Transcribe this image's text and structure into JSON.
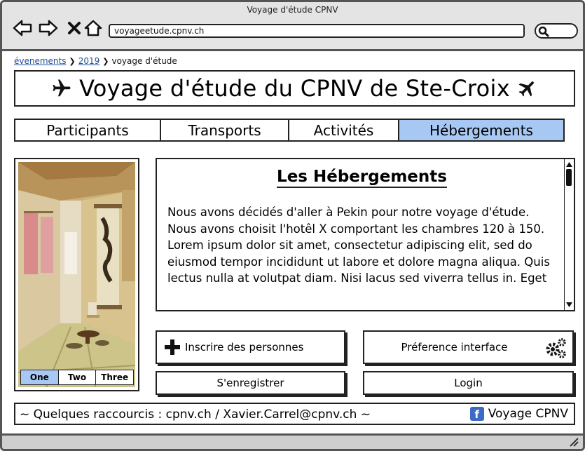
{
  "window": {
    "title": "Voyage d'étude CPNV",
    "url": "voyageetude.cpnv.ch"
  },
  "breadcrumb": {
    "items": [
      "évenements",
      "2019",
      "voyage d'étude"
    ]
  },
  "header": {
    "title": "Voyage d'étude du CPNV de Ste-Croix"
  },
  "tabs": [
    {
      "label": "Participants",
      "active": false
    },
    {
      "label": "Transports",
      "active": false
    },
    {
      "label": "Activités",
      "active": false
    },
    {
      "label": "Hébergements",
      "active": true
    }
  ],
  "carousel": {
    "buttons": [
      "One",
      "Two",
      "Three"
    ],
    "selected": "One"
  },
  "content": {
    "heading": "Les Hébergements",
    "body": "Nous avons décidés d'aller à Pekin pour notre voyage d'étude. Nous avons choisit l'hotêl X comportant les chambres 120 à 150. Lorem ipsum dolor sit amet, consectetur adipiscing elit, sed do eiusmod tempor incididunt ut labore et dolore magna aliqua. Quis lectus nulla at volutpat diam. Nisi lacus sed viverra tellus in. Eget"
  },
  "actions": {
    "register_people": "Inscrire des personnes",
    "preferences": "Préference interface",
    "signup": "S'enregistrer",
    "login": "Login"
  },
  "footer": {
    "shortcuts": "~ Quelques raccourcis : cpnv.ch / Xavier.Carrel@cpnv.ch ~",
    "facebook_label": "Voyage CPNV"
  },
  "colors": {
    "active_tab": "#a8c8f4",
    "link": "#1f4fa0",
    "facebook": "#3b6bc4"
  }
}
